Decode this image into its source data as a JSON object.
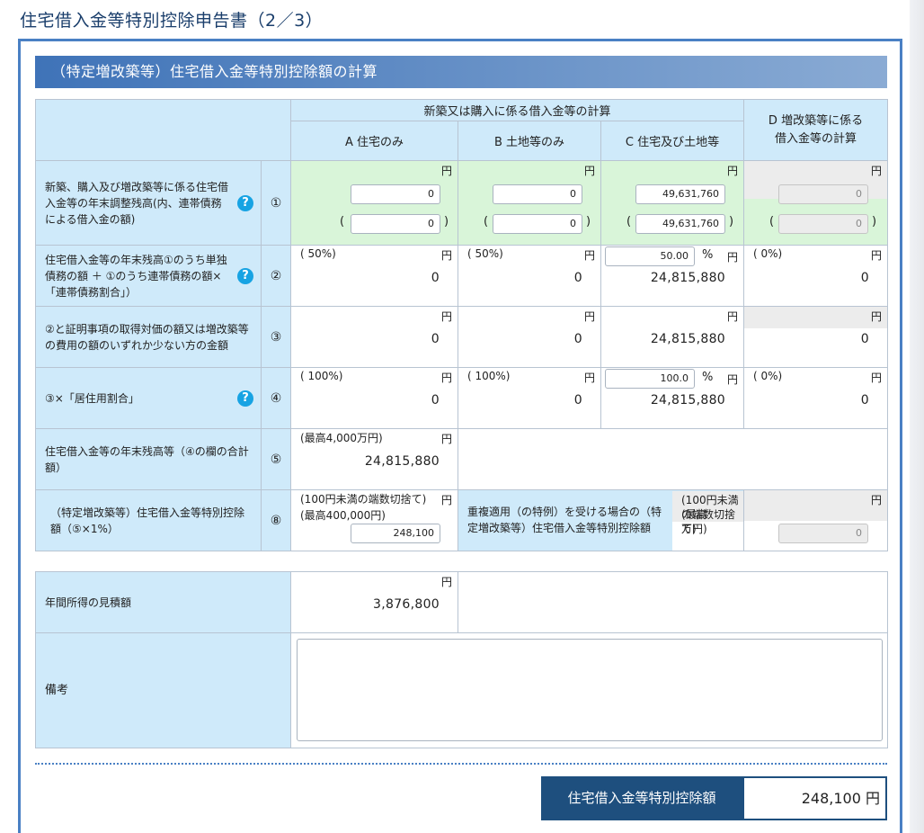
{
  "page": {
    "title": "住宅借入金等特別控除申告書（2／3）"
  },
  "section": {
    "title": "（特定増改築等）住宅借入金等特別控除額の計算"
  },
  "headers": {
    "group": "新築又は購入に係る借入金等の計算",
    "col_a": "A 住宅のみ",
    "col_b": "B 土地等のみ",
    "col_c": "C 住宅及び土地等",
    "col_d_line1": "D 増改築等に係る",
    "col_d_line2": "借入金等の計算"
  },
  "common": {
    "yen": "円",
    "percent_sign": "%",
    "help": "?",
    "open_paren": "(",
    "close_paren": ")"
  },
  "rows": {
    "r1": {
      "label": "新築、購入及び増改築等に係る住宅借入金等の年末調整残高(内、連帯債務による借入金の額)",
      "num": "①",
      "a": "0",
      "a_inner": "0",
      "b": "0",
      "b_inner": "0",
      "c": "49,631,760",
      "c_inner": "49,631,760",
      "d": "0",
      "d_inner": "0"
    },
    "r2": {
      "label": "住宅借入金等の年末残高①のうち単独債務の額 ＋ ①のうち連帯債務の額×「連帯債務割合」）",
      "num": "②",
      "a_pct": "( 50%)",
      "a": "0",
      "b_pct": "( 50%)",
      "b": "0",
      "c_pct_input": "50.00",
      "c": "24,815,880",
      "d_pct": "( 0%)",
      "d": "0"
    },
    "r3": {
      "label": "②と証明事項の取得対価の額又は増改築等の費用の額のいずれか少ない方の金額",
      "num": "③",
      "a": "0",
      "b": "0",
      "c": "24,815,880",
      "d": "0"
    },
    "r4": {
      "label": "③×「居住用割合」",
      "num": "④",
      "a_pct": "( 100%)",
      "a": "0",
      "b_pct": "( 100%)",
      "b": "0",
      "c_pct_input": "100.0",
      "c": "24,815,880",
      "d_pct": "( 0%)",
      "d": "0"
    },
    "r5": {
      "label": "住宅借入金等の年末残高等（④の欄の合計額）",
      "num": "⑤",
      "note": "(最高4,000万円)",
      "value": "24,815,880"
    },
    "r8": {
      "label": "（特定増改築等）住宅借入金等特別控除額（⑤×1%）",
      "num": "⑧",
      "note_line1": "(100円未満の端数切捨て)",
      "note_line2": "(最高400,000円)",
      "value": "248,100",
      "dup_label": "重複適用（の特例）を受ける場合の（特定増改築等）住宅借入金等特別控除額",
      "dup_note_line1": "(100円未満の端数切捨て)",
      "dup_note_line2": "(最高　　　　万円)",
      "dup_value": "0"
    },
    "income": {
      "label": "年間所得の見積額",
      "value": "3,876,800"
    },
    "remarks": {
      "label": "備考",
      "value": ""
    }
  },
  "total": {
    "label": "住宅借入金等特別控除額",
    "value": "248,100 円"
  }
}
